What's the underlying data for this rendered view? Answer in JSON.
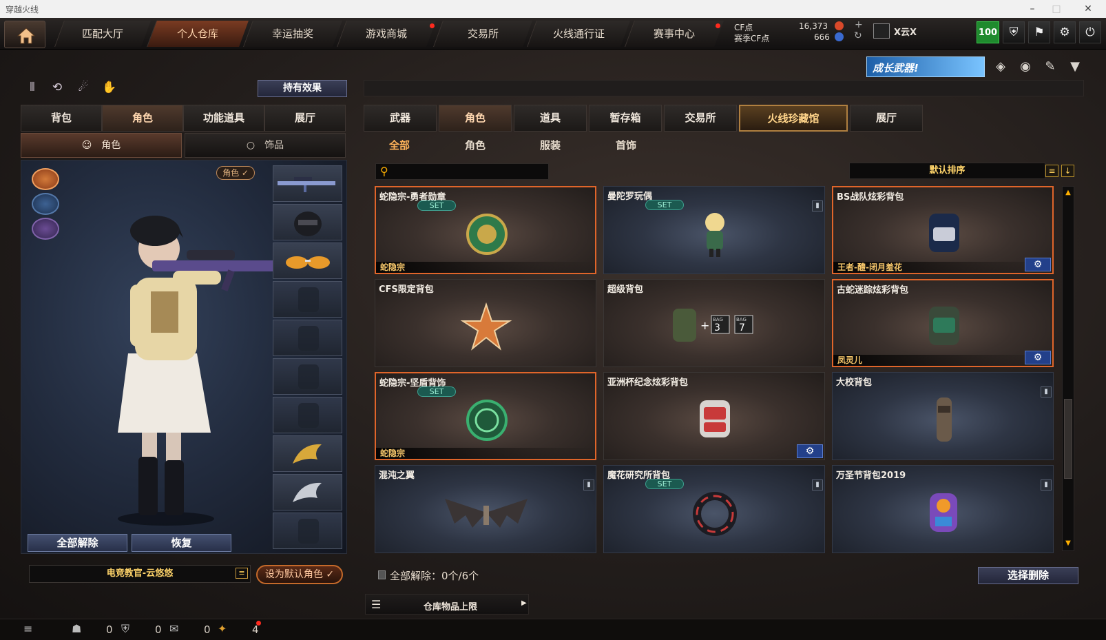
{
  "window": {
    "title": "穿越火线"
  },
  "nav": {
    "tabs": [
      "匹配大厅",
      "个人仓库",
      "幸运抽奖",
      "游戏商城",
      "交易所",
      "火线通行证",
      "赛事中心"
    ],
    "active": "个人仓库"
  },
  "currency": {
    "cf_label": "CF点",
    "cf_value": "16,373",
    "season_label": "赛季CF点",
    "season_value": "666"
  },
  "user": {
    "name": "X云X",
    "level": "100"
  },
  "banner": {
    "text": "成长武器!"
  },
  "left": {
    "effect_button": "持有效果",
    "tabs": [
      "背包",
      "角色",
      "功能道具",
      "展厅"
    ],
    "subtabs": [
      "角色",
      "饰品"
    ],
    "role_badge": "角色 ✓",
    "unequip_all": "全部解除",
    "restore": "恢复",
    "character_name": "电竞教官-云悠悠",
    "set_default": "设为默认角色 ✓"
  },
  "right": {
    "tabs": [
      "武器",
      "角色",
      "道具",
      "暂存箱",
      "交易所",
      "火线珍藏馆",
      "展厅"
    ],
    "subtabs": [
      "全部",
      "角色",
      "服装",
      "首饰"
    ],
    "search_placeholder": "",
    "sort_label": "默认排序",
    "items": [
      {
        "name": "蛇隐宗-勇者勋章",
        "set": "SET",
        "footer": "蛇隐宗",
        "icon": "medal-icon"
      },
      {
        "name": "曼陀罗玩偶",
        "set": "SET",
        "footer": "",
        "icon": "doll-icon"
      },
      {
        "name": "BS战队炫彩背包",
        "set": "",
        "footer": "王者-醴-闭月羞花",
        "icon": "backpack-icon"
      },
      {
        "name": "CFS限定背包",
        "set": "",
        "footer": "",
        "icon": "star-badge-icon"
      },
      {
        "name": "超级背包",
        "set": "",
        "footer": "",
        "icon": "bag-expansion-icon"
      },
      {
        "name": "古蛇迷踪炫彩背包",
        "set": "",
        "footer": "凤灵儿",
        "icon": "backpack-icon"
      },
      {
        "name": "蛇隐宗-坚盾背饰",
        "set": "SET",
        "footer": "蛇隐宗",
        "icon": "shield-emblem-icon"
      },
      {
        "name": "亚洲杯纪念炫彩背包",
        "set": "",
        "footer": "",
        "icon": "backpack-icon"
      },
      {
        "name": "大校背包",
        "set": "",
        "footer": "",
        "icon": "backpack-icon"
      },
      {
        "name": "混沌之翼",
        "set": "",
        "footer": "",
        "icon": "wings-icon"
      },
      {
        "name": "魔花研究所背包",
        "set": "SET",
        "footer": "",
        "icon": "ring-icon"
      },
      {
        "name": "万圣节背包2019",
        "set": "",
        "footer": "",
        "icon": "backpack-icon"
      }
    ],
    "super_bag_labels": [
      "BAG",
      "3",
      "BAG",
      "7"
    ],
    "unequip_count": "全部解除：0个/6个",
    "delete_button": "选择删除",
    "capacity_label": "仓库物品上限"
  },
  "status": {
    "a": "0",
    "b": "0",
    "c": "0",
    "d": "4"
  }
}
